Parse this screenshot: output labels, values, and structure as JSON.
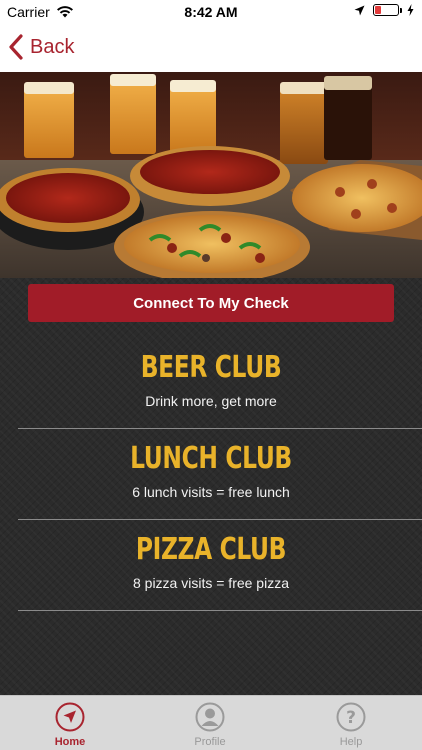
{
  "status_bar": {
    "carrier": "Carrier",
    "time": "8:42 AM",
    "battery_level": 0.25,
    "battery_color": "#e23b3b"
  },
  "nav": {
    "back_label": "Back"
  },
  "hero": {
    "image": "pizza-and-beer-photo"
  },
  "connect_button": {
    "label": "Connect To My Check"
  },
  "clubs": [
    {
      "title": "BEER CLUB",
      "subtitle": "Drink more, get more"
    },
    {
      "title": "LUNCH CLUB",
      "subtitle": "6 lunch visits = free lunch"
    },
    {
      "title": "PIZZA CLUB",
      "subtitle": "8 pizza visits = free pizza"
    }
  ],
  "tabs": [
    {
      "label": "Home",
      "icon": "navigation-arrow-icon",
      "active": true
    },
    {
      "label": "Profile",
      "icon": "person-icon",
      "active": false
    },
    {
      "label": "Help",
      "icon": "question-icon",
      "active": false
    }
  ],
  "colors": {
    "accent": "#a8242f",
    "club_title": "#e9b32a",
    "button": "#a11c28"
  }
}
